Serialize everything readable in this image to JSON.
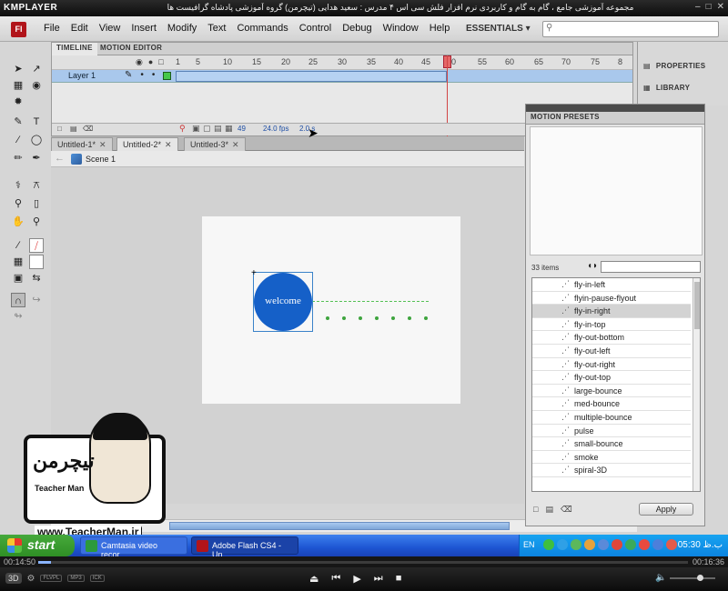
{
  "player": {
    "logo": "KMPLAYER",
    "caption": "مجموعه آموزشی جامع ، گام به گام و کاربردی نرم افزار فلش سی اس ۴ مدرس : سعید هدایی (تیچرمن) گروه آموزشی پادشاه گرافیست ها",
    "controls": [
      "–",
      "□",
      "✕"
    ],
    "time_elapsed": "00:14:50",
    "time_total": "00:16:36",
    "progress": 0.02,
    "chips": [
      "FLVPL",
      "MP3",
      "ICK"
    ],
    "mode_3d": "3D"
  },
  "flash": {
    "app_icon": "Fl",
    "menu": [
      "File",
      "Edit",
      "View",
      "Insert",
      "Modify",
      "Text",
      "Commands",
      "Control",
      "Debug",
      "Window",
      "Help"
    ],
    "workspace": "ESSENTIALS ▾",
    "search_placeholder": ""
  },
  "timeline": {
    "tabs": [
      "TIMELINE",
      "MOTION EDITOR"
    ],
    "frame_numbers": [
      "1",
      "5",
      "10",
      "15",
      "20",
      "25",
      "30",
      "35",
      "40",
      "45",
      "50",
      "55",
      "60",
      "65",
      "70",
      "75",
      "8"
    ],
    "layer_name": "Layer 1",
    "current_frame": "49",
    "fps": "24.0 fps",
    "time": "2.0 s"
  },
  "dock": {
    "properties": "PROPERTIES",
    "library": "LIBRARY"
  },
  "documents": {
    "tabs": [
      "Untitled-1*",
      "Untitled-2*",
      "Untitled-3*"
    ],
    "active_index": 1,
    "scene": "Scene 1"
  },
  "stage": {
    "symbol_text": "welcome",
    "symbol_color": "#1560c8",
    "path_color": "#54c054"
  },
  "motion_presets": {
    "title": "MOTION PRESETS",
    "count": "33 items",
    "items": [
      "fly-in-left",
      "flyin-pause-flyout",
      "fly-in-right",
      "fly-in-top",
      "fly-out-bottom",
      "fly-out-left",
      "fly-out-right",
      "fly-out-top",
      "large-bounce",
      "med-bounce",
      "multiple-bounce",
      "pulse",
      "small-bounce",
      "smoke",
      "spiral-3D"
    ],
    "selected_index": 2,
    "apply_label": "Apply"
  },
  "watermark": {
    "brand": "تیچرمن",
    "name": "Teacher Man",
    "url": "www.TeacherMan.ir"
  },
  "taskbar": {
    "start": "start",
    "tasks": [
      "Camtasia video recor...",
      "Adobe Flash CS4 - Un..."
    ],
    "lang": "EN",
    "clock": "05:30 ب.ظ"
  }
}
